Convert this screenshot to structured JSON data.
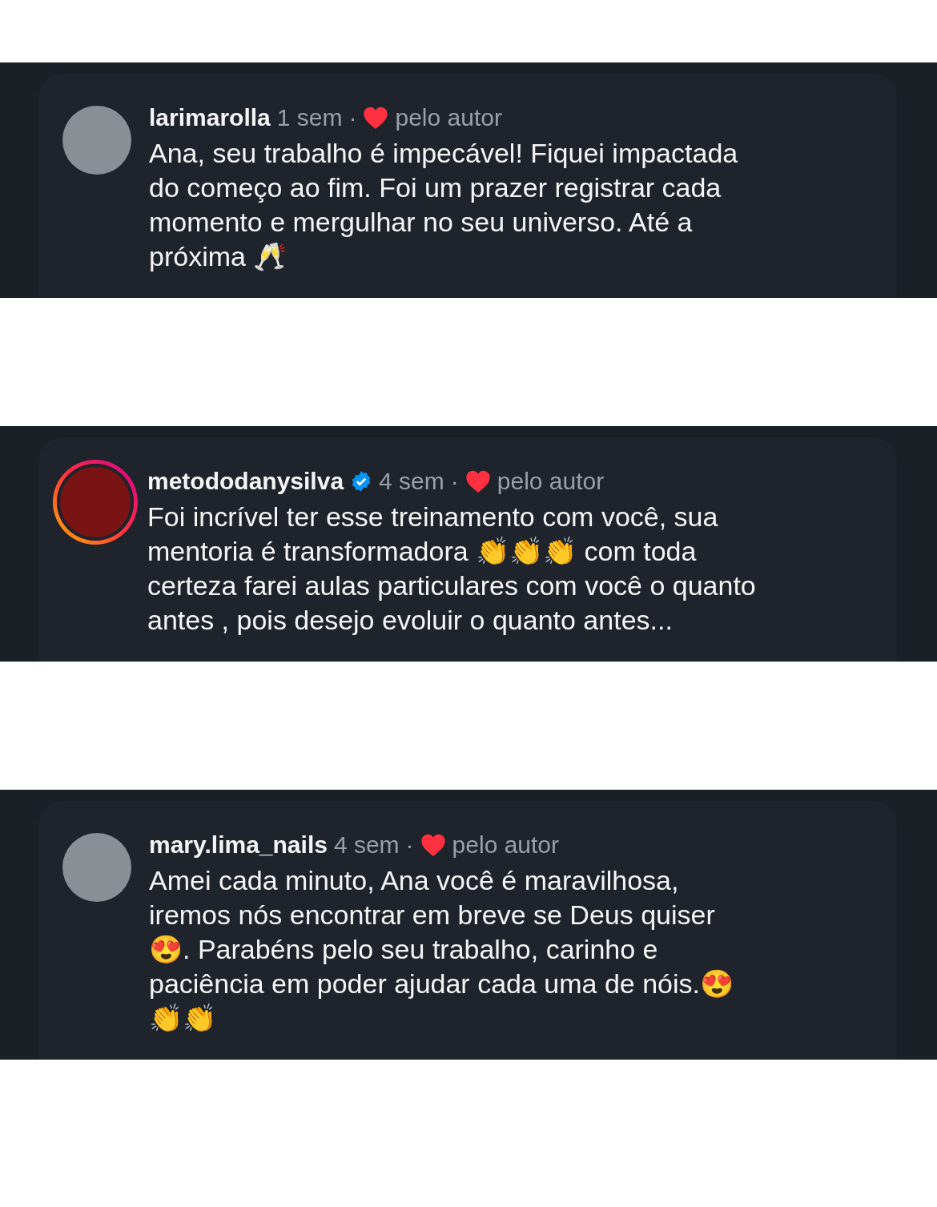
{
  "comments": [
    {
      "username": "larimarolla",
      "verified": false,
      "story_ring": false,
      "time": "1 sem",
      "separator": "·",
      "liked_by_author": true,
      "liked_label": "pelo autor",
      "text": "Ana, seu trabalho é impecável! Fiquei impactada do começo ao fim. Foi um prazer registrar cada momento e mergulhar no seu universo. Até a próxima 🥂"
    },
    {
      "username": "metododanysilva",
      "verified": true,
      "story_ring": true,
      "time": "4 sem",
      "separator": "·",
      "liked_by_author": true,
      "liked_label": "pelo autor",
      "text": "Foi incrível ter esse treinamento com você, sua mentoria é transformadora 👏👏👏 com toda certeza farei aulas particulares com você o quanto antes , pois desejo evoluir o quanto antes..."
    },
    {
      "username": "mary.lima_nails",
      "verified": false,
      "story_ring": false,
      "time": "4 sem",
      "separator": "·",
      "liked_by_author": true,
      "liked_label": "pelo autor",
      "text": "Amei cada minuto, Ana você é maravilhosa, iremos nós encontrar em breve se Deus quiser 😍. Parabéns pelo seu trabalho, carinho e paciência em poder ajudar cada uma de nóis.😍👏👏"
    }
  ]
}
